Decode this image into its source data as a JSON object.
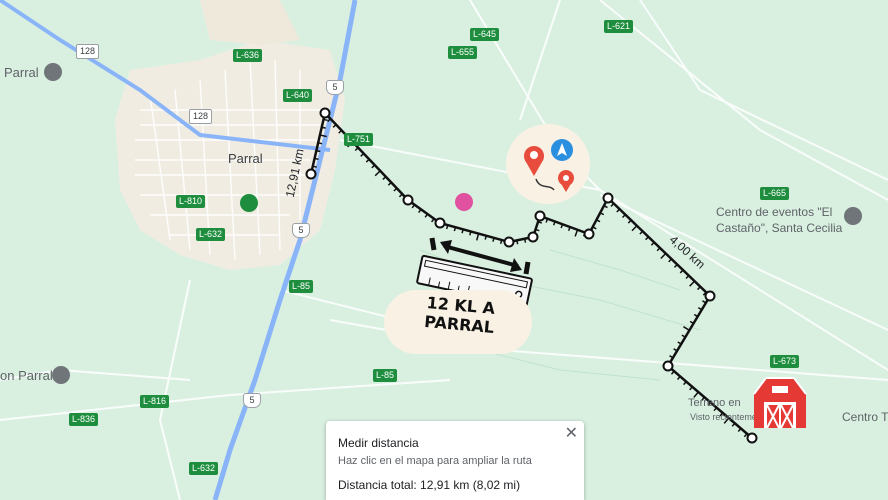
{
  "map": {
    "places": {
      "city": "Parral",
      "parral_poi": "Parral",
      "church": "on Parral",
      "events_line1": "Centro de eventos \"El",
      "events_line2": "Castaño\", Santa Cecilia",
      "terrain": "Terreno en",
      "terrain_sub": "Visto recientemente",
      "centro_right": "Centro T"
    },
    "road_labels": [
      "128",
      "128",
      "L-636",
      "L-655",
      "L-645",
      "L-621",
      "L-640",
      "L-751",
      "L-810",
      "L-632",
      "L-85",
      "L-85",
      "L-816",
      "L-836",
      "L-632",
      "L-665",
      "L-673"
    ],
    "highway_labels": [
      "5",
      "5",
      "5"
    ],
    "measure_labels": {
      "segment_a": "12,91 km",
      "segment_b": "4,00 km"
    },
    "annotation": "12 KL A PARRAL",
    "colors": {
      "map_bg": "#d9f0e1",
      "route_line": "#111111",
      "highway": "#8ab4f8",
      "urban": "#f0ece2"
    }
  },
  "measure_panel": {
    "title": "Medir distancia",
    "hint": "Haz clic en el mapa para ampliar la ruta",
    "total": "Distancia total: 12,91 km (8,02 mi)",
    "close_icon": "close-icon"
  }
}
